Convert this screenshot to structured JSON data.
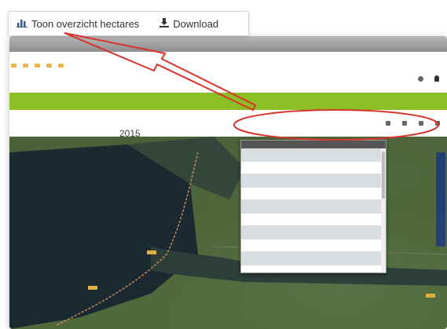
{
  "callout": {
    "overview_label": "Toon overzicht hectares",
    "download_label": "Download"
  },
  "year": "2015",
  "colors": {
    "accent_green": "#8cbf26",
    "annotation_red": "#d9342b"
  }
}
